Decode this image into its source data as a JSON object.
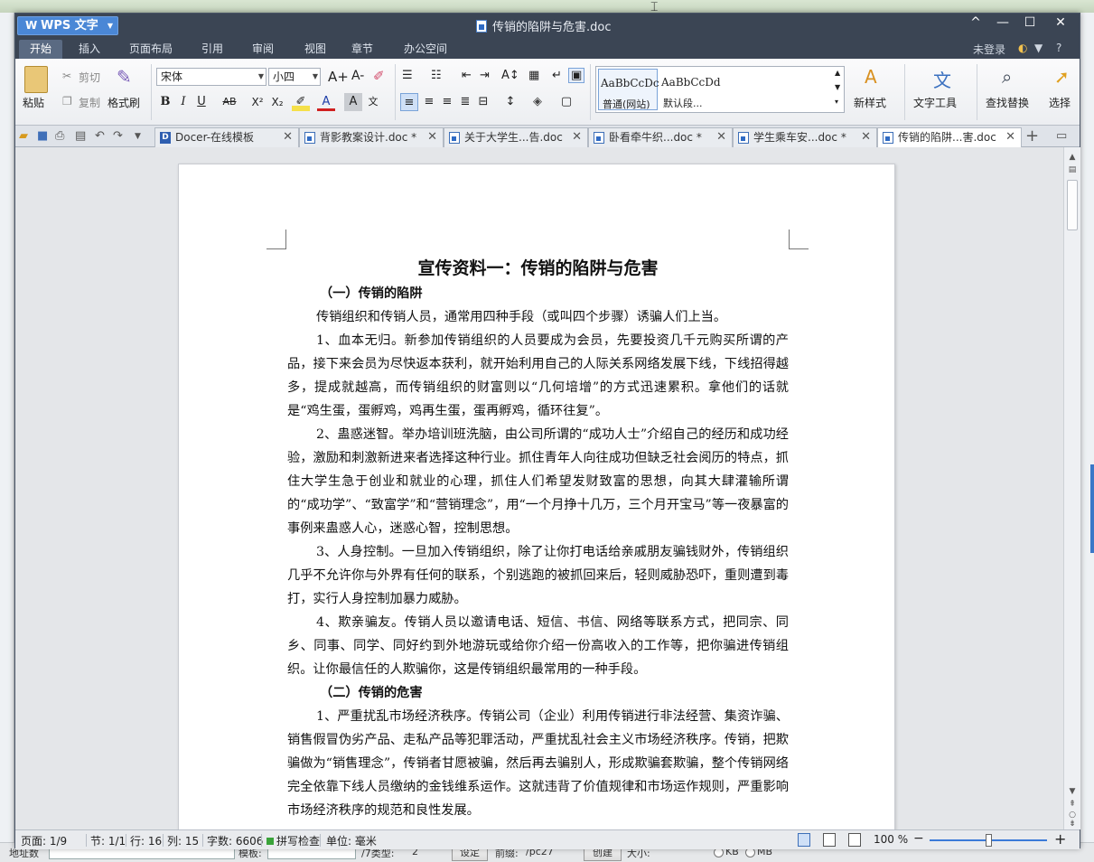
{
  "app": {
    "menu_label": "WPS 文字",
    "window_title": "传销的陷阱与危害.doc",
    "controls": {
      "collapse": "^",
      "minimize": "—",
      "maximize": "☐",
      "close": "✕"
    }
  },
  "menubar": {
    "tabs": [
      "开始",
      "插入",
      "页面布局",
      "引用",
      "审阅",
      "视图",
      "章节",
      "办公空间"
    ],
    "active_index": 0,
    "login": "未登录",
    "help": "?"
  },
  "ribbon": {
    "paste": "粘贴",
    "cut": "剪切",
    "copy": "复制",
    "format_painter": "格式刷",
    "font_name": "宋体",
    "font_size": "小四",
    "bold": "B",
    "italic": "I",
    "underline": "U",
    "strike": "AB",
    "superscript": "X²",
    "subscript": "X₂",
    "font_color_glyph": "A",
    "char_shade_glyph": "A",
    "grow": "A+",
    "shrink": "A-",
    "style_samples": [
      {
        "sample": "AaBbCcDc",
        "name": "普通(网站)"
      },
      {
        "sample": "AaBbCcDd",
        "name": "默认段..."
      }
    ],
    "new_style": "新样式",
    "text_tools": "文字工具",
    "find_replace": "查找替换",
    "select": "选择"
  },
  "tabs": [
    {
      "label": "Docer-在线模板",
      "kind": "docer"
    },
    {
      "label": "背影教案设计.doc *",
      "kind": "doc"
    },
    {
      "label": "关于大学生...告.doc",
      "kind": "doc"
    },
    {
      "label": "卧看牵牛织...doc *",
      "kind": "doc"
    },
    {
      "label": "学生乘车安...doc *",
      "kind": "doc"
    },
    {
      "label": "传销的陷阱...害.doc",
      "kind": "doc",
      "active": true
    }
  ],
  "document": {
    "title": "宣传资料一：传销的陷阱与危害",
    "h_trap": "（一）传销的陷阱",
    "p_intro": "传销组织和传销人员，通常用四种手段（或叫四个步骤）诱骗人们上当。",
    "p1": "1、血本无归。新参加传销组织的人员要成为会员，先要投资几千元购买所谓的产品，接下来会员为尽快返本获利，就开始利用自己的人际关系网络发展下线，下线招得越多，提成就越高，而传销组织的财富则以“几何培增”的方式迅速累积。拿他们的话就是“鸡生蛋，蛋孵鸡，鸡再生蛋，蛋再孵鸡，循环往复”。",
    "p2": "2、蛊惑迷智。举办培训班洗脑，由公司所谓的“成功人士”介绍自己的经历和成功经验，激励和刺激新进来者选择这种行业。抓住青年人向往成功但缺乏社会阅历的特点，抓住大学生急于创业和就业的心理，抓住人们希望发财致富的思想，向其大肆灌输所谓的“成功学”、“致富学”和“营销理念”，用“一个月挣十几万，三个月开宝马”等一夜暴富的事例来蛊惑人心，迷惑心智，控制思想。",
    "p3": "3、人身控制。一旦加入传销组织，除了让你打电话给亲戚朋友骗钱财外，传销组织几乎不允许你与外界有任何的联系，个别逃跑的被抓回来后，轻则威胁恐吓，重则遭到毒打，实行人身控制加暴力威胁。",
    "p4": "4、欺亲骗友。传销人员以邀请电话、短信、书信、网络等联系方式，把同宗、同乡、同事、同学、同好约到外地游玩或给你介绍一份高收入的工作等，把你骗进传销组织。让你最信任的人欺骗你，这是传销组织最常用的一种手段。",
    "h_harm": "（二）传销的危害",
    "p5": "1、严重扰乱市场经济秩序。传销公司（企业）利用传销进行非法经营、集资诈骗、销售假冒伪劣产品、走私产品等犯罪活动，严重扰乱社会主义市场经济秩序。传销，把欺骗做为“销售理念”，传销者甘愿被骗，然后再去骗别人，形成欺骗套欺骗，整个传销网络完全依靠下线人员缴纳的金钱维系运作。这就违背了价值规律和市场运作规则，严重影响市场经济秩序的规范和良性发展。"
  },
  "status": {
    "page": "页面: 1/9",
    "section": "节: 1/1",
    "row": "行: 16",
    "col": "列: 15",
    "words": "字数: 6606",
    "spell": "拼写检查",
    "unit": "单位: 毫米",
    "zoom": "100 %",
    "zoom_level_percent": 100
  },
  "background": {
    "label_address": "地址数",
    "label_mode": "模板:",
    "label_type": "/7类型:",
    "type_value": "2",
    "btn_set": "设定",
    "label_prefix": "前缀:",
    "prefix_value": "/pc27",
    "btn_create": "创建",
    "label_size": "大小:",
    "radio_kb": "KB",
    "radio_mb": "MB"
  }
}
